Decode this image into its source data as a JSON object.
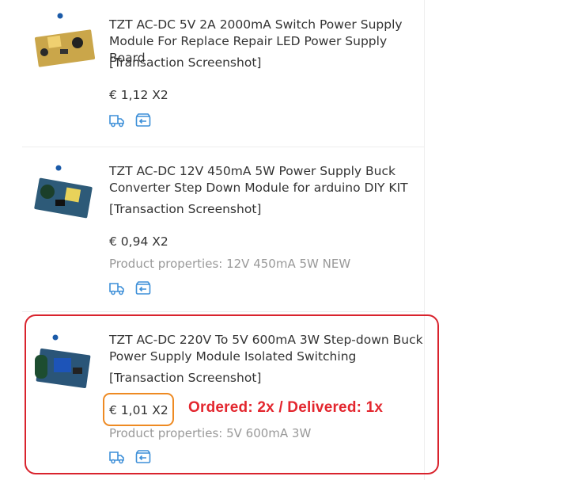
{
  "orders": [
    {
      "title_line1": "TZT AC-DC 5V 2A 2000mA Switch Power Supply",
      "title_line2": "Module For Replace Repair LED Power Supply Board",
      "snapshot_label": "[Transaction Screenshot]",
      "price": "€ 1,12 X2",
      "properties": ""
    },
    {
      "title_line1": "TZT AC-DC 12V 450mA 5W Power Supply Buck",
      "title_line2": "Converter Step Down Module for arduino DIY KIT",
      "snapshot_label": "[Transaction Screenshot]",
      "price": "€ 0,94 X2",
      "properties": "Product properties: 12V 450mA 5W NEW"
    },
    {
      "title_line1": "TZT AC-DC 220V To 5V 600mA 3W Step-down Buck",
      "title_line2": "Power Supply Module Isolated Switching",
      "snapshot_label": "[Transaction Screenshot]",
      "price": "€ 1,01 X2",
      "properties": "Product properties: 5V 600mA 3W"
    }
  ],
  "annotation": {
    "text": "Ordered: 2x / Delivered: 1x",
    "highlight_color": "#d9232d",
    "price_highlight_color": "#ee8a22"
  },
  "icons": {
    "shipping": "truck-icon",
    "return": "return-box-icon",
    "icon_color": "#3d8fd8"
  }
}
